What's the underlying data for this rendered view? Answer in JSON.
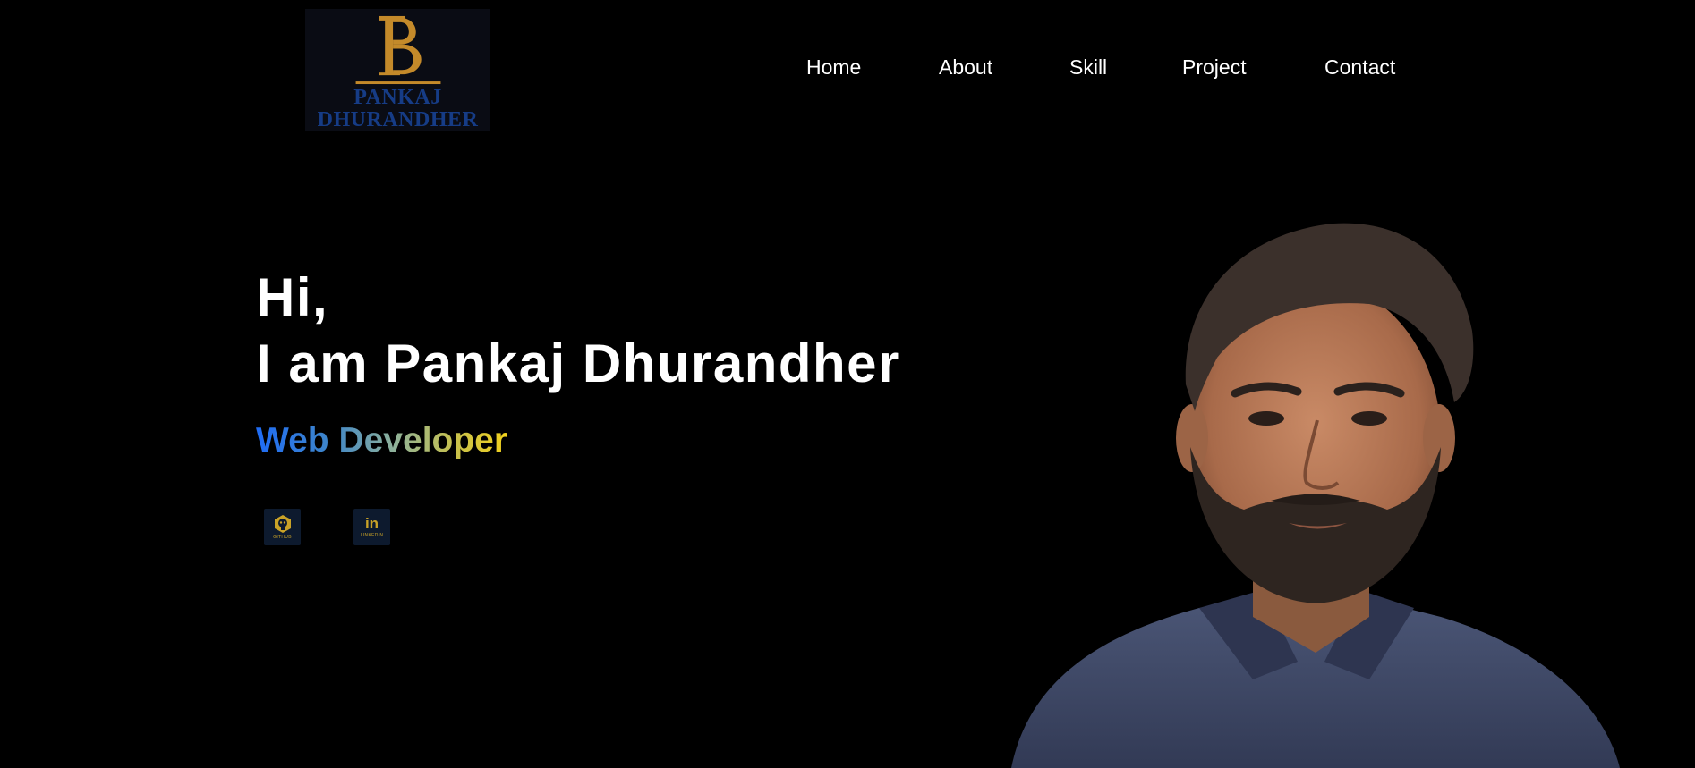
{
  "logo": {
    "monogram": "PD",
    "name_line1": "PANKAJ",
    "name_line2": "DHURANDHER",
    "gold": "#c48a2a",
    "blue": "#163c86"
  },
  "nav": {
    "items": [
      {
        "label": "Home"
      },
      {
        "label": "About"
      },
      {
        "label": "Skill"
      },
      {
        "label": "Project"
      },
      {
        "label": "Contact"
      }
    ]
  },
  "hero": {
    "greeting": "Hi,",
    "intro": "I am Pankaj Dhurandher",
    "role": "Web Developer"
  },
  "social": {
    "github_caption": "GITHUB",
    "linkedin_caption": "LINKEDIN",
    "linkedin_glyph": "in",
    "icon_color": "#c9a227",
    "icon_bg": "#0d1a2e"
  },
  "portrait": {
    "icon": "person-photo"
  },
  "colors": {
    "background": "#000000",
    "text": "#ffffff",
    "gradient_start": "#1f6cf5",
    "gradient_end": "#f2d21c"
  }
}
